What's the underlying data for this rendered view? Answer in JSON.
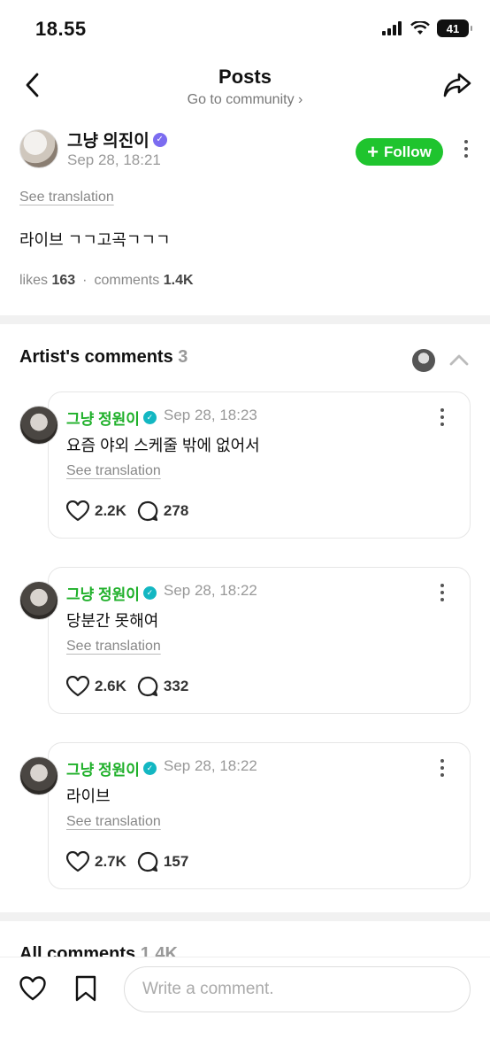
{
  "status": {
    "time": "18.55",
    "battery": "41"
  },
  "nav": {
    "title": "Posts",
    "subtitle": "Go to community ›"
  },
  "post": {
    "author": "그냥 의진이",
    "time": "Sep 28, 18:21",
    "follow_label": "Follow",
    "see_translation": "See translation",
    "body": "라이브 ㄱㄱ고곡ㄱㄱㄱ",
    "likes_label": "likes",
    "likes_count": "163",
    "comments_label": "comments",
    "comments_count": "1.4K"
  },
  "artist_comments": {
    "title": "Artist's comments",
    "count": "3",
    "items": [
      {
        "name": "그냥 정원이",
        "time": "Sep 28, 18:23",
        "text": "요즘 야외 스케줄 밖에 없어서",
        "see_translation": "See translation",
        "likes": "2.2K",
        "replies": "278"
      },
      {
        "name": "그냥 정원이",
        "time": "Sep 28, 18:22",
        "text": "당분간 못해여",
        "see_translation": "See translation",
        "likes": "2.6K",
        "replies": "332"
      },
      {
        "name": "그냥 정원이",
        "time": "Sep 28, 18:22",
        "text": "라이브",
        "see_translation": "See translation",
        "likes": "2.7K",
        "replies": "157"
      }
    ]
  },
  "all_comments": {
    "title": "All comments",
    "count": "1.4K"
  },
  "bottom": {
    "placeholder": "Write a comment."
  },
  "colors": {
    "follow_green": "#1fc42e",
    "artist_name_green": "#1fb02a",
    "verified_badge": "#13b7c2"
  },
  "icons": [
    "back-chevron-icon",
    "share-icon",
    "verified-badge-icon",
    "more-vertical-icon",
    "chevron-up-icon",
    "heart-icon",
    "comment-bubble-icon",
    "bookmark-icon",
    "signal-icon",
    "wifi-icon",
    "battery-icon"
  ]
}
